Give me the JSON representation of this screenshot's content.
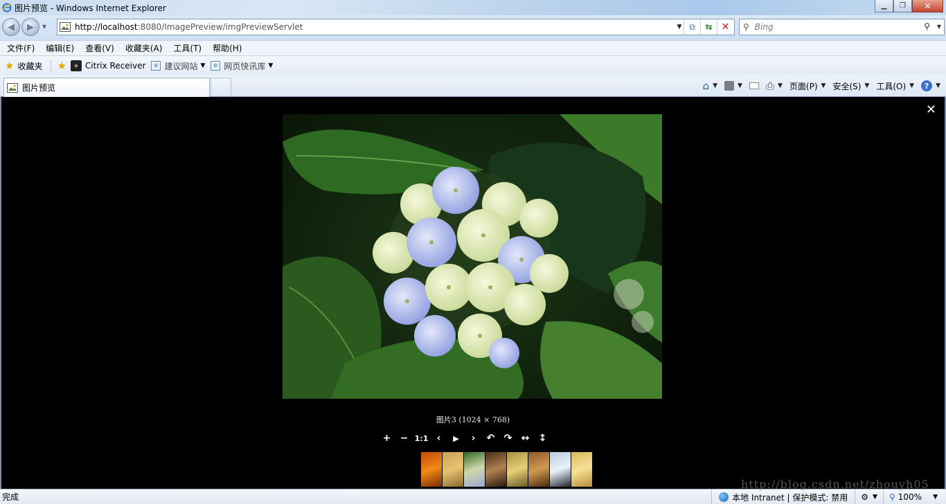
{
  "window": {
    "title": "图片预览 - Windows Internet Explorer",
    "controls": {
      "minimize": "▁",
      "maximize": "❐",
      "close": "✕"
    }
  },
  "address": {
    "url_host": "http://localhost",
    "url_rest": ":8080/ImagePreview/imgPreviewServlet",
    "search_placeholder": "Bing"
  },
  "menu": [
    "文件(F)",
    "编辑(E)",
    "查看(V)",
    "收藏夹(A)",
    "工具(T)",
    "帮助(H)"
  ],
  "favorites": {
    "label": "收藏夹",
    "items": [
      "Citrix Receiver",
      "建议网站",
      "网页快讯库"
    ]
  },
  "tab": {
    "label": "图片预览"
  },
  "commands": {
    "page": "页面(P)",
    "safety": "安全(S)",
    "tools": "工具(O)"
  },
  "viewer": {
    "caption": "图片3 (1024 × 768)",
    "tools": [
      "+",
      "−",
      "1:1",
      "‹",
      "▶",
      "›",
      "↶",
      "↷",
      "↔",
      "↕"
    ],
    "thumbnails": [
      {
        "name": "thumb-1",
        "colors": [
          "#c24a08",
          "#f08a18",
          "#7a2c04"
        ]
      },
      {
        "name": "thumb-2",
        "colors": [
          "#c9a258",
          "#e8c270",
          "#8a6a30"
        ]
      },
      {
        "name": "thumb-3",
        "colors": [
          "#2f6a2a",
          "#cfd8a8",
          "#9aa8d8"
        ]
      },
      {
        "name": "thumb-4",
        "colors": [
          "#4a3018",
          "#b08050",
          "#2a1a0c"
        ]
      },
      {
        "name": "thumb-5",
        "colors": [
          "#a89040",
          "#e8d078",
          "#6a5a28"
        ]
      },
      {
        "name": "thumb-6",
        "colors": [
          "#8a5a2a",
          "#d09a50",
          "#4a2a10"
        ]
      },
      {
        "name": "thumb-7",
        "colors": [
          "#b8cde0",
          "#e8f0f8",
          "#20262c"
        ]
      },
      {
        "name": "thumb-8",
        "colors": [
          "#d8b858",
          "#f8e098",
          "#b89038"
        ]
      }
    ]
  },
  "status": {
    "text": "完成",
    "zone": "本地 Intranet | 保护模式: 禁用",
    "zoom": "100%",
    "watermark": "http://blog.csdn.net/zhouyh05"
  }
}
